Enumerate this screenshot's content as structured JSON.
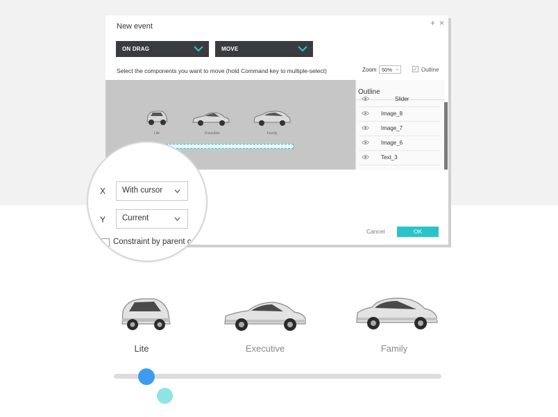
{
  "dialog": {
    "title": "New event",
    "window_controls": {
      "plus": "+",
      "close": "×"
    },
    "trigger_dropdown": {
      "value": "ON DRAG"
    },
    "action_dropdown": {
      "value": "MOVE"
    },
    "instruction": "Select the components you want to move (hold Command key to multiple-select)",
    "zoom": {
      "label": "Zoom",
      "value": "50%"
    },
    "outline_toggle": {
      "label": "Outline",
      "checked": true
    },
    "preview": {
      "cars": [
        {
          "label": "Lite"
        },
        {
          "label": "Executive"
        },
        {
          "label": "Family"
        }
      ]
    },
    "outline_panel": {
      "title": "Outline",
      "items": [
        {
          "name": "Slider"
        },
        {
          "name": "Image_8"
        },
        {
          "name": "Image_7"
        },
        {
          "name": "Image_6"
        },
        {
          "name": "Text_3"
        }
      ]
    },
    "cancel_label": "Cancel",
    "ok_label": "OK"
  },
  "magnifier": {
    "x": {
      "axis": "X",
      "value": "With cursor"
    },
    "y": {
      "axis": "Y",
      "value": "Current"
    },
    "constraint_label": "Constraint by parent c"
  },
  "slider_widget": {
    "cars": [
      {
        "label": "Lite"
      },
      {
        "label": "Executive"
      },
      {
        "label": "Family"
      }
    ],
    "selected": "Lite",
    "position_fraction": 0.1
  },
  "colors": {
    "accent": "#29c4c9",
    "thumb": "#3d9cf0",
    "dropdown_bg": "#3a3b3f"
  }
}
